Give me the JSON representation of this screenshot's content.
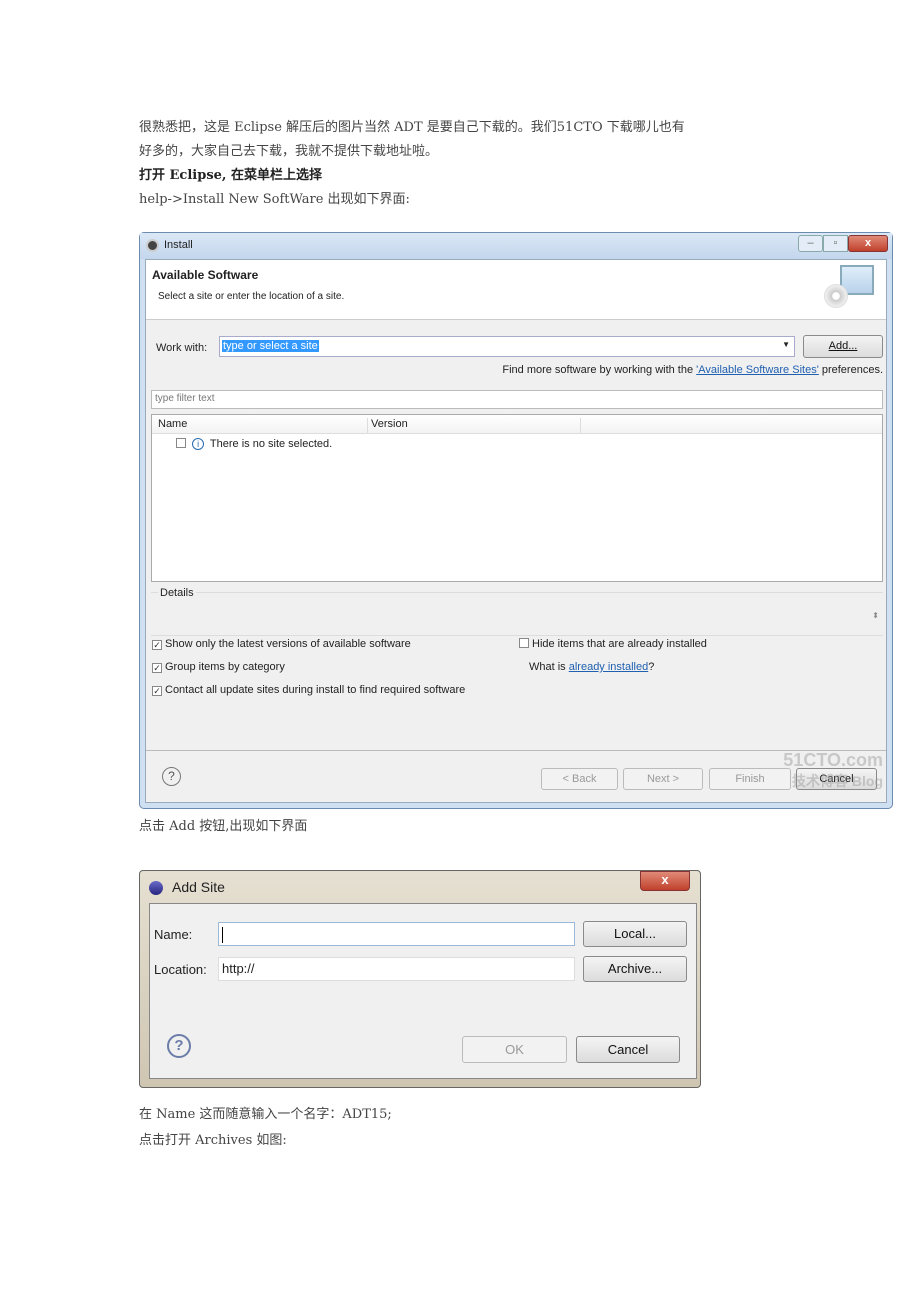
{
  "article": {
    "p1": "很熟悉把，这是 Eclipse 解压后的图片当然 ADT 是要自己下载的。我们51CTO 下载哪儿也有",
    "p2": "好多的，大家自己去下载，我就不提供下载地址啦。",
    "p3": "打开 Eclipse, 在菜单栏上选择",
    "p4": "help->Install New SoftWare 出现如下界面:",
    "p5": "点击 Add 按钮,出现如下界面",
    "p6": "在 Name 这而随意输入一个名字：ADT15;",
    "p7": "点击打开 Archives 如图:"
  },
  "install": {
    "title": "Install",
    "header_title": "Available Software",
    "header_sub": "Select a site or enter the location of a site.",
    "work_with_label": "Work with:",
    "work_with_value": "type or select a site",
    "add_label": "Add...",
    "find_more_prefix": "Find more software by working with the ",
    "find_more_link": "'Available Software Sites'",
    "find_more_suffix": " preferences.",
    "filter_placeholder": "type filter text",
    "columns": [
      "Name",
      "Version"
    ],
    "row": "There is no site selected.",
    "details_label": "Details",
    "options": [
      {
        "label": "Show only the latest versions of available software",
        "checked": true
      },
      {
        "label": "Group items by category",
        "checked": true
      },
      {
        "label": "Contact all update sites during install to find required software",
        "checked": true
      },
      {
        "label": "Hide items that are already installed",
        "checked": false
      }
    ],
    "what_is_prefix": "What is ",
    "what_is_link": "already installed",
    "what_is_suffix": "?",
    "back": "< Back",
    "next": "Next >",
    "finish": "Finish",
    "cancel": "Cancel",
    "watermark": "51CTO.com 技术博客 Blog"
  },
  "add_site": {
    "title": "Add Site",
    "name_label": "Name:",
    "name_value": "",
    "location_label": "Location:",
    "location_value": "http://",
    "local": "Local...",
    "archive": "Archive...",
    "ok": "OK",
    "cancel": "Cancel"
  }
}
